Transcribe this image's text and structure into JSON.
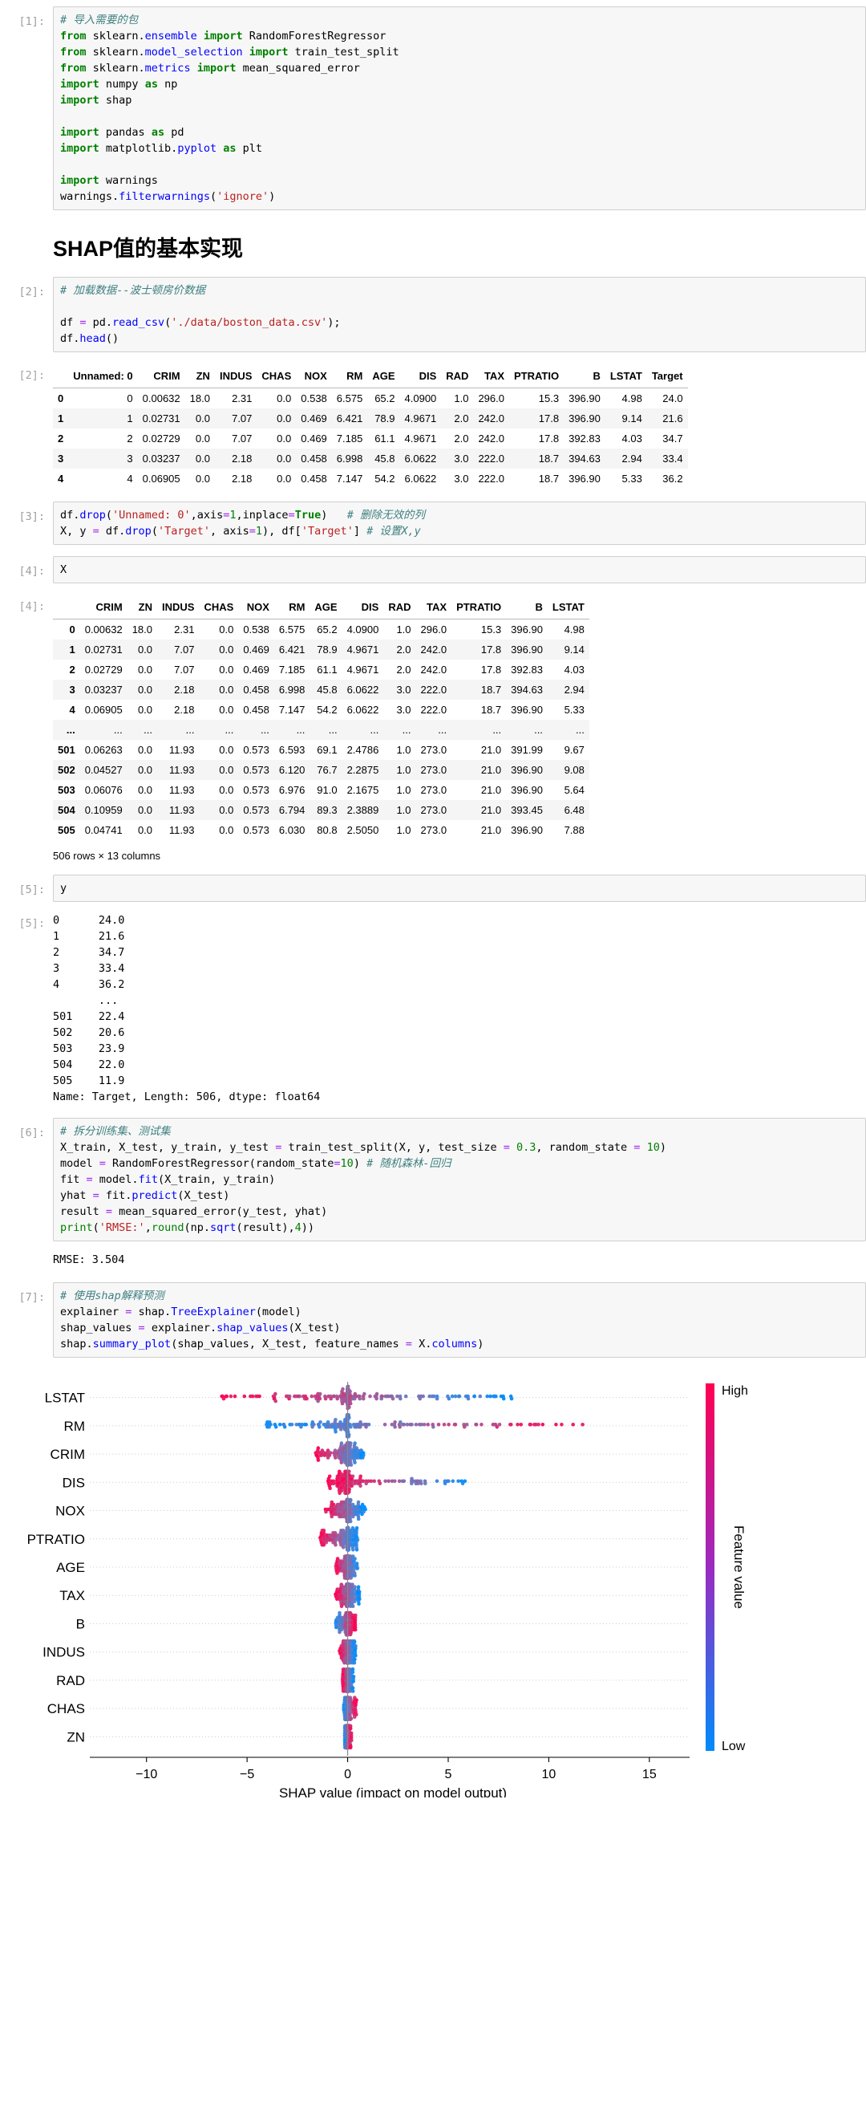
{
  "notebook": {
    "cells": [
      {
        "prompt": "[1]:",
        "code_lines": [
          {
            "t": "comment",
            "v": "# 导入需要的包"
          },
          {
            "t": "code",
            "v": "from sklearn.ensemble import RandomForestRegressor"
          },
          {
            "t": "code",
            "v": "from sklearn.model_selection import train_test_split"
          },
          {
            "t": "code",
            "v": "from sklearn.metrics import mean_squared_error"
          },
          {
            "t": "code",
            "v": "import numpy as np"
          },
          {
            "t": "code",
            "v": "import shap"
          },
          {
            "t": "code",
            "v": ""
          },
          {
            "t": "code",
            "v": "import pandas as pd"
          },
          {
            "t": "code",
            "v": "import matplotlib.pyplot as plt"
          },
          {
            "t": "code",
            "v": ""
          },
          {
            "t": "code",
            "v": "import warnings"
          },
          {
            "t": "code",
            "v": "warnings.filterwarnings('ignore')"
          }
        ]
      }
    ]
  },
  "heading": {
    "text": "SHAP值的基本实现"
  },
  "cell1": {
    "prompt": "[1]:",
    "line1": "# 导入需要的包",
    "line2_a": "from",
    "line2_b": " sklearn.",
    "line2_c": "ensemble",
    "line2_d": " import",
    "line2_e": " RandomForestRegressor",
    "line3_c": "model_selection",
    "line3_e": " train_test_split",
    "line4_c": "metrics",
    "line4_e": " mean_squared_error",
    "line5": "import numpy as np",
    "line6": "import shap",
    "line7": "import pandas as pd",
    "line8": "import matplotlib.pyplot as plt",
    "line9": "import warnings",
    "line10": "warnings.filterwarnings('ignore')"
  },
  "cell2": {
    "prompt": "[2:]",
    "prompt_in": "[2]:",
    "prompt_out": "[2]:",
    "comment": "# 加载数据--波士顿房价数据",
    "code_line1": "df = pd.read_csv('./data/boston_data.csv');",
    "code_line2": "df.head()"
  },
  "df_head": {
    "columns": [
      "Unnamed: 0",
      "CRIM",
      "ZN",
      "INDUS",
      "CHAS",
      "NOX",
      "RM",
      "AGE",
      "DIS",
      "RAD",
      "TAX",
      "PTRATIO",
      "B",
      "LSTAT",
      "Target"
    ],
    "rows": [
      {
        "idx": "0",
        "cells": [
          "0",
          "0.00632",
          "18.0",
          "2.31",
          "0.0",
          "0.538",
          "6.575",
          "65.2",
          "4.0900",
          "1.0",
          "296.0",
          "15.3",
          "396.90",
          "4.98",
          "24.0"
        ]
      },
      {
        "idx": "1",
        "cells": [
          "1",
          "0.02731",
          "0.0",
          "7.07",
          "0.0",
          "0.469",
          "6.421",
          "78.9",
          "4.9671",
          "2.0",
          "242.0",
          "17.8",
          "396.90",
          "9.14",
          "21.6"
        ]
      },
      {
        "idx": "2",
        "cells": [
          "2",
          "0.02729",
          "0.0",
          "7.07",
          "0.0",
          "0.469",
          "7.185",
          "61.1",
          "4.9671",
          "2.0",
          "242.0",
          "17.8",
          "392.83",
          "4.03",
          "34.7"
        ]
      },
      {
        "idx": "3",
        "cells": [
          "3",
          "0.03237",
          "0.0",
          "2.18",
          "0.0",
          "0.458",
          "6.998",
          "45.8",
          "6.0622",
          "3.0",
          "222.0",
          "18.7",
          "394.63",
          "2.94",
          "33.4"
        ]
      },
      {
        "idx": "4",
        "cells": [
          "4",
          "0.06905",
          "0.0",
          "2.18",
          "0.0",
          "0.458",
          "7.147",
          "54.2",
          "6.0622",
          "3.0",
          "222.0",
          "18.7",
          "396.90",
          "5.33",
          "36.2"
        ]
      }
    ]
  },
  "cell3": {
    "prompt": "[3]:",
    "line1_a": "df.",
    "line1_b": "drop",
    "line1_c": "(",
    "line1_s": "'Unnamed: 0'",
    "line1_d": ",axis",
    "line1_eq": "=",
    "line1_n": "1",
    "line1_e": ",inplace",
    "line1_t": "True",
    "line1_f": ")",
    "line1_comment": "   # 删除无效的列",
    "line2_full": "X, y = df.drop('Target', axis=1), df['Target'] # 设置X,y"
  },
  "cell4": {
    "prompt_in": "[4]:",
    "prompt_out": "[4]:",
    "code": "X"
  },
  "df_X": {
    "columns": [
      "CRIM",
      "ZN",
      "INDUS",
      "CHAS",
      "NOX",
      "RM",
      "AGE",
      "DIS",
      "RAD",
      "TAX",
      "PTRATIO",
      "B",
      "LSTAT"
    ],
    "rows": [
      {
        "idx": "0",
        "cells": [
          "0.00632",
          "18.0",
          "2.31",
          "0.0",
          "0.538",
          "6.575",
          "65.2",
          "4.0900",
          "1.0",
          "296.0",
          "15.3",
          "396.90",
          "4.98"
        ]
      },
      {
        "idx": "1",
        "cells": [
          "0.02731",
          "0.0",
          "7.07",
          "0.0",
          "0.469",
          "6.421",
          "78.9",
          "4.9671",
          "2.0",
          "242.0",
          "17.8",
          "396.90",
          "9.14"
        ]
      },
      {
        "idx": "2",
        "cells": [
          "0.02729",
          "0.0",
          "7.07",
          "0.0",
          "0.469",
          "7.185",
          "61.1",
          "4.9671",
          "2.0",
          "242.0",
          "17.8",
          "392.83",
          "4.03"
        ]
      },
      {
        "idx": "3",
        "cells": [
          "0.03237",
          "0.0",
          "2.18",
          "0.0",
          "0.458",
          "6.998",
          "45.8",
          "6.0622",
          "3.0",
          "222.0",
          "18.7",
          "394.63",
          "2.94"
        ]
      },
      {
        "idx": "4",
        "cells": [
          "0.06905",
          "0.0",
          "2.18",
          "0.0",
          "0.458",
          "7.147",
          "54.2",
          "6.0622",
          "3.0",
          "222.0",
          "18.7",
          "396.90",
          "5.33"
        ]
      },
      {
        "idx": "...",
        "cells": [
          "...",
          "...",
          "...",
          "...",
          "...",
          "...",
          "...",
          "...",
          "...",
          "...",
          "...",
          "...",
          "..."
        ]
      },
      {
        "idx": "501",
        "cells": [
          "0.06263",
          "0.0",
          "11.93",
          "0.0",
          "0.573",
          "6.593",
          "69.1",
          "2.4786",
          "1.0",
          "273.0",
          "21.0",
          "391.99",
          "9.67"
        ]
      },
      {
        "idx": "502",
        "cells": [
          "0.04527",
          "0.0",
          "11.93",
          "0.0",
          "0.573",
          "6.120",
          "76.7",
          "2.2875",
          "1.0",
          "273.0",
          "21.0",
          "396.90",
          "9.08"
        ]
      },
      {
        "idx": "503",
        "cells": [
          "0.06076",
          "0.0",
          "11.93",
          "0.0",
          "0.573",
          "6.976",
          "91.0",
          "2.1675",
          "1.0",
          "273.0",
          "21.0",
          "396.90",
          "5.64"
        ]
      },
      {
        "idx": "504",
        "cells": [
          "0.10959",
          "0.0",
          "11.93",
          "0.0",
          "0.573",
          "6.794",
          "89.3",
          "2.3889",
          "1.0",
          "273.0",
          "21.0",
          "393.45",
          "6.48"
        ]
      },
      {
        "idx": "505",
        "cells": [
          "0.04741",
          "0.0",
          "11.93",
          "0.0",
          "0.573",
          "6.030",
          "80.8",
          "2.5050",
          "1.0",
          "273.0",
          "21.0",
          "396.90",
          "7.88"
        ]
      }
    ],
    "shape": "506 rows × 13 columns"
  },
  "cell5": {
    "prompt_in": "[5]:",
    "prompt_out": "[5]:",
    "code": "y",
    "output": "0      24.0\n1      21.6\n2      34.7\n3      33.4\n4      36.2\n       ... \n501    22.4\n502    20.6\n503    23.9\n504    22.0\n505    11.9\nName: Target, Length: 506, dtype: float64"
  },
  "cell6": {
    "prompt": "[6]:",
    "comment": "# 拆分训练集、测试集",
    "l2_pre": "X_train, X_test, y_train, y_test ",
    "l2_eq": "=",
    "l2_f": " train_test_split(X, y, test_size ",
    "l2_eq2": "=",
    "l2_n": " 0.3",
    "l2_mid": ", random_state ",
    "l2_eq3": "=",
    "l2_n2": " 10",
    "l2_end": ")",
    "l3_pre": "model ",
    "l3_eq": "=",
    "l3_f": " RandomForestRegressor(random_state",
    "l3_eq2": "=",
    "l3_n": "10",
    "l3_end": ")",
    "l3_c": " # 随机森林-回归",
    "l4": "fit = model.fit(X_train, y_train)",
    "l5": "yhat = fit.predict(X_test)",
    "l6": "result = mean_squared_error(y_test, yhat)",
    "l7": "print('RMSE:',round(np.sqrt(result),4))",
    "output": "RMSE: 3.504"
  },
  "cell7": {
    "prompt": "[7]:",
    "comment": "# 使用shap解释预测",
    "l2": "explainer = shap.TreeExplainer(model)",
    "l3": "shap_values = explainer.shap_values(X_test)",
    "l4": "shap.summary_plot(shap_values, X_test, feature_names = X.columns)"
  },
  "chart_data": {
    "type": "scatter",
    "subtype": "shap-beeswarm",
    "title": "",
    "xlabel": "SHAP value (impact on model output)",
    "ylabel": "",
    "xlim": [
      -12.5,
      17.0
    ],
    "xticks": [
      -10,
      -5,
      0,
      5,
      10,
      15
    ],
    "xticklabels": [
      "−10",
      "−5",
      "0",
      "5",
      "10",
      "15"
    ],
    "grid": "dotted-horizontal",
    "zero_line": 0,
    "colorbar": {
      "label": "Feature value",
      "high_label": "High",
      "low_label": "Low",
      "high_color": "#ff0051",
      "low_color": "#008bfb",
      "position": "right"
    },
    "categories": [
      "LSTAT",
      "RM",
      "CRIM",
      "DIS",
      "NOX",
      "PTRATIO",
      "AGE",
      "TAX",
      "B",
      "INDUS",
      "RAD",
      "CHAS",
      "ZN"
    ],
    "series": [
      {
        "name": "LSTAT",
        "x_range": [
          -6.6,
          8.3
        ],
        "spread": "wide",
        "n": 152,
        "points": [
          [
            -6.5,
            0.95
          ],
          [
            -6.2,
            0.95
          ],
          [
            -5.9,
            0.92
          ],
          [
            -5.6,
            0.9
          ],
          [
            -5.3,
            0.92
          ],
          [
            -5.0,
            0.9
          ],
          [
            -4.6,
            0.9
          ],
          [
            -4.3,
            0.88
          ],
          [
            -4.0,
            0.9
          ],
          [
            -3.7,
            0.9
          ],
          [
            -3.4,
            0.88
          ],
          [
            -3.1,
            0.86
          ],
          [
            -2.8,
            0.85
          ],
          [
            -2.5,
            0.82
          ],
          [
            -2.2,
            0.8
          ],
          [
            -1.9,
            0.78
          ],
          [
            -1.6,
            0.72
          ],
          [
            -1.3,
            0.68
          ],
          [
            -1.0,
            0.62
          ],
          [
            -0.7,
            0.55
          ],
          [
            -0.4,
            0.48
          ],
          [
            -0.1,
            0.42
          ],
          [
            0.2,
            0.38
          ],
          [
            0.5,
            0.32
          ],
          [
            0.9,
            0.28
          ],
          [
            1.3,
            0.22
          ],
          [
            1.8,
            0.18
          ],
          [
            2.3,
            0.14
          ],
          [
            2.9,
            0.1
          ],
          [
            3.5,
            0.08
          ],
          [
            4.2,
            0.07
          ],
          [
            5.0,
            0.06
          ],
          [
            5.8,
            0.05
          ],
          [
            6.6,
            0.05
          ],
          [
            7.4,
            0.04
          ],
          [
            8.2,
            0.03
          ]
        ]
      },
      {
        "name": "RM",
        "x_range": [
          -4.2,
          11.7
        ],
        "spread": "wide",
        "n": 152,
        "points": [
          [
            -4.1,
            0.2
          ],
          [
            -3.8,
            0.25
          ],
          [
            -3.5,
            0.28
          ],
          [
            -3.2,
            0.3
          ],
          [
            -2.9,
            0.28
          ],
          [
            -2.6,
            0.26
          ],
          [
            -2.3,
            0.24
          ],
          [
            -2.0,
            0.22
          ],
          [
            -1.6,
            0.2
          ],
          [
            -1.2,
            0.18
          ],
          [
            -0.8,
            0.2
          ],
          [
            -0.4,
            0.3
          ],
          [
            0.0,
            0.45
          ],
          [
            0.4,
            0.6
          ],
          [
            0.8,
            0.68
          ],
          [
            1.2,
            0.72
          ],
          [
            1.7,
            0.76
          ],
          [
            2.2,
            0.8
          ],
          [
            2.8,
            0.82
          ],
          [
            3.4,
            0.85
          ],
          [
            4.1,
            0.88
          ],
          [
            4.8,
            0.9
          ],
          [
            5.6,
            0.92
          ],
          [
            6.4,
            0.93
          ],
          [
            7.2,
            0.94
          ],
          [
            8.0,
            0.95
          ],
          [
            8.8,
            0.96
          ],
          [
            9.6,
            0.96
          ],
          [
            10.4,
            0.97
          ],
          [
            11.2,
            0.97
          ],
          [
            11.6,
            0.98
          ]
        ]
      },
      {
        "name": "CRIM",
        "x_range": [
          -1.6,
          0.8
        ],
        "spread": "narrow",
        "n": 152
      },
      {
        "name": "DIS",
        "x_range": [
          -1.0,
          6.0
        ],
        "spread": "narrow",
        "n": 152
      },
      {
        "name": "NOX",
        "x_range": [
          -1.2,
          0.9
        ],
        "spread": "narrow",
        "n": 152
      },
      {
        "name": "PTRATIO",
        "x_range": [
          -1.4,
          0.5
        ],
        "spread": "narrow",
        "n": 152
      },
      {
        "name": "AGE",
        "x_range": [
          -0.6,
          0.5
        ],
        "spread": "narrow",
        "n": 152
      },
      {
        "name": "TAX",
        "x_range": [
          -0.6,
          0.6
        ],
        "spread": "narrow",
        "n": 152
      },
      {
        "name": "B",
        "x_range": [
          -0.6,
          0.4
        ],
        "spread": "narrow",
        "n": 152
      },
      {
        "name": "INDUS",
        "x_range": [
          -0.4,
          0.4
        ],
        "spread": "narrow",
        "n": 152
      },
      {
        "name": "RAD",
        "x_range": [
          -0.25,
          0.3
        ],
        "spread": "narrow",
        "n": 152
      },
      {
        "name": "CHAS",
        "x_range": [
          -0.2,
          0.45
        ],
        "spread": "narrow",
        "n": 152
      },
      {
        "name": "ZN",
        "x_range": [
          -0.15,
          0.2
        ],
        "spread": "narrow",
        "n": 152
      }
    ]
  }
}
